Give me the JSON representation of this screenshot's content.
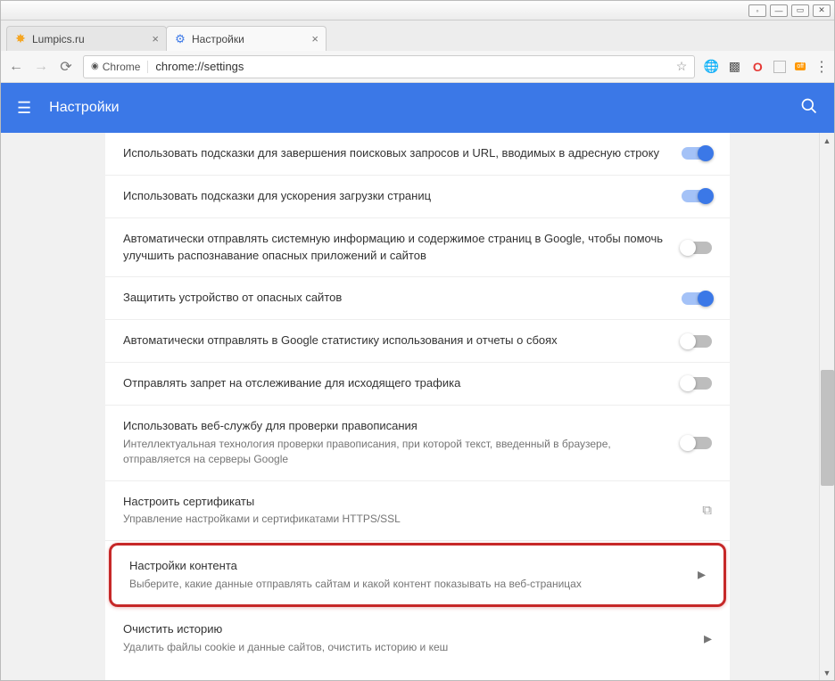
{
  "window": {
    "tabs": [
      {
        "title": "Lumpics.ru",
        "active": false
      },
      {
        "title": "Настройки",
        "active": true
      }
    ]
  },
  "addressbar": {
    "security_label": "Chrome",
    "url": "chrome://settings"
  },
  "header": {
    "title": "Настройки"
  },
  "rows": [
    {
      "title": "Использовать подсказки для завершения поисковых запросов и URL, вводимых в адресную строку",
      "sub": "",
      "control": "toggle",
      "state": "on"
    },
    {
      "title": "Использовать подсказки для ускорения загрузки страниц",
      "sub": "",
      "control": "toggle",
      "state": "on"
    },
    {
      "title": "Автоматически отправлять системную информацию и содержимое страниц в Google, чтобы помочь улучшить распознавание опасных приложений и сайтов",
      "sub": "",
      "control": "toggle",
      "state": "off"
    },
    {
      "title": "Защитить устройство от опасных сайтов",
      "sub": "",
      "control": "toggle",
      "state": "on"
    },
    {
      "title": "Автоматически отправлять в Google статистику использования и отчеты о сбоях",
      "sub": "",
      "control": "toggle",
      "state": "off"
    },
    {
      "title": "Отправлять запрет на отслеживание для исходящего трафика",
      "sub": "",
      "control": "toggle",
      "state": "off"
    },
    {
      "title": "Использовать веб-службу для проверки правописания",
      "sub": "Интеллектуальная технология проверки правописания, при которой текст, введенный в браузере, отправляется на серверы Google",
      "control": "toggle",
      "state": "off"
    },
    {
      "title": "Настроить сертификаты",
      "sub": "Управление настройками и сертификатами HTTPS/SSL",
      "control": "open"
    },
    {
      "title": "Настройки контента",
      "sub": "Выберите, какие данные отправлять сайтам и какой контент показывать на веб-страницах",
      "control": "chevron",
      "highlight": true
    },
    {
      "title": "Очистить историю",
      "sub": "Удалить файлы cookie и данные сайтов, очистить историю и кеш",
      "control": "chevron"
    }
  ],
  "ext_off_label": "off"
}
